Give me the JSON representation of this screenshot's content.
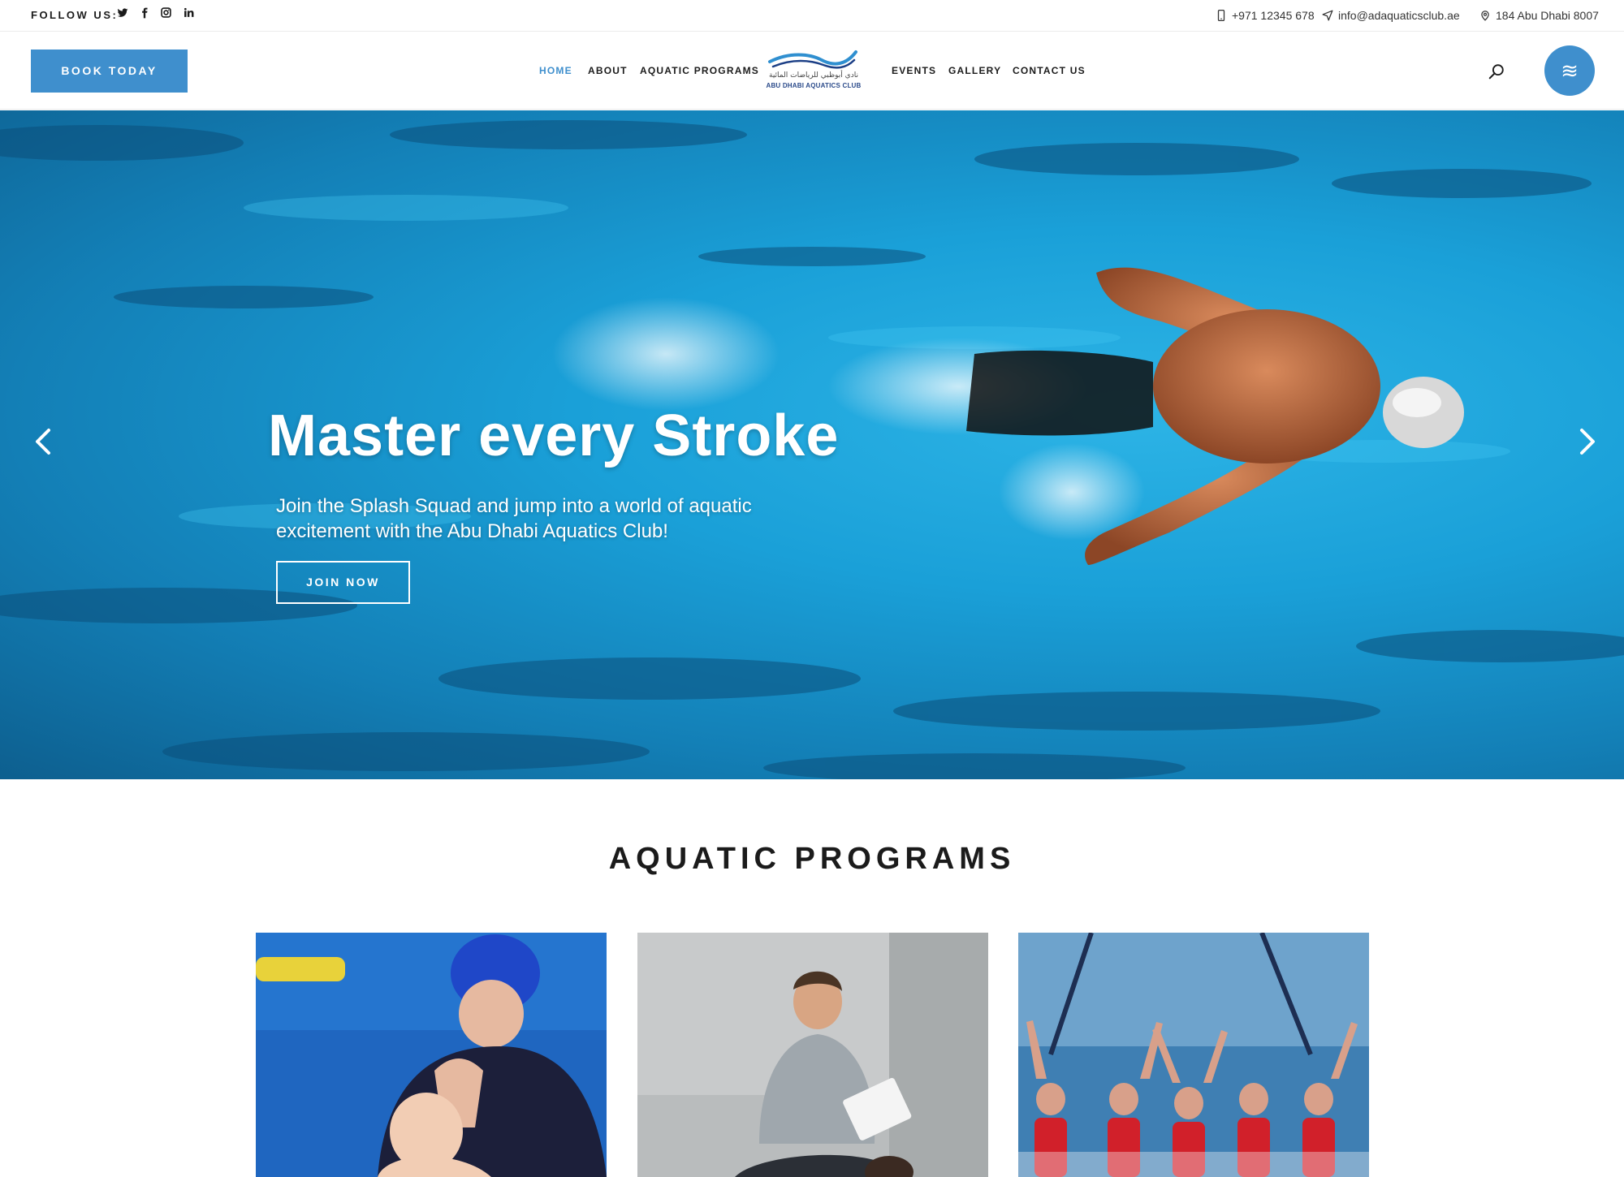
{
  "topbar": {
    "follow_label": "FOLLOW US:",
    "social_icons": [
      "twitter-icon",
      "facebook-icon",
      "instagram-icon",
      "linkedin-icon"
    ],
    "phone": "+971 12345 678",
    "email": "info@adaquaticsclub.ae",
    "address": "184 Abu Dhabi 8007"
  },
  "header": {
    "book_label": "BOOK TODAY",
    "nav": [
      {
        "label": "HOME",
        "active": true
      },
      {
        "label": "ABOUT"
      },
      {
        "label": "AQUATIC PROGRAMS"
      },
      {
        "label": "EVENTS"
      },
      {
        "label": "GALLERY"
      },
      {
        "label": "CONTACT US"
      }
    ],
    "logo": {
      "arabic": "نادي أبوظبي للرياضات المائية",
      "english": "ABU DHABI AQUATICS CLUB"
    },
    "menu_glyph": "≋"
  },
  "hero": {
    "title": "Master every Stroke",
    "subtitle": "Join the Splash Squad and jump into a world of aquatic excitement with the Abu Dhabi Aquatics Club!",
    "cta_label": "JOIN NOW"
  },
  "programs": {
    "title": "AQUATIC PROGRAMS"
  },
  "colors": {
    "accent": "#3f8fcd",
    "water": "#1aa0d8",
    "text_dark": "#1b1b1b"
  }
}
